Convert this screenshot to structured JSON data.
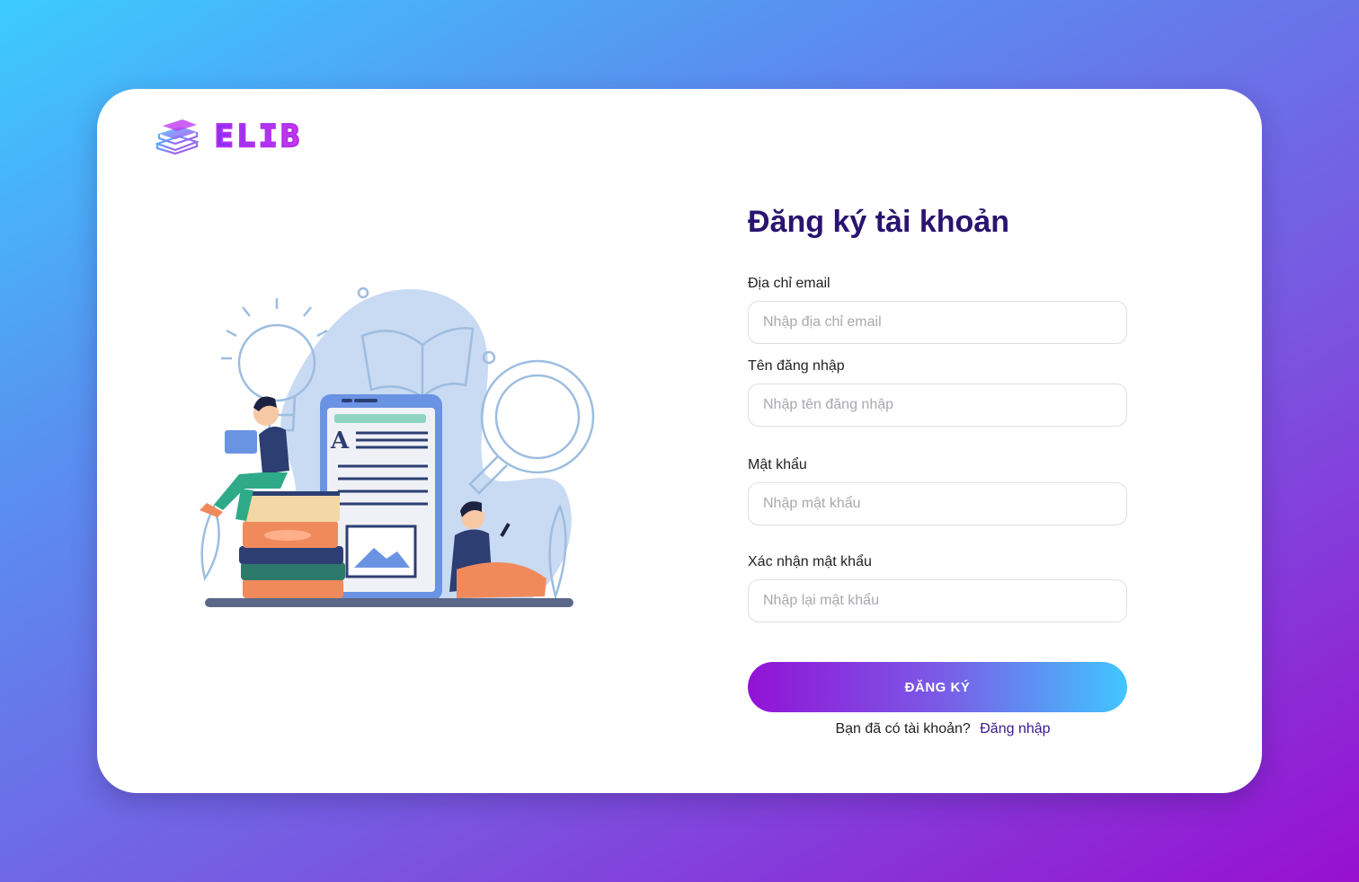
{
  "brand": {
    "name": "ELIB"
  },
  "form": {
    "title": "Đăng ký tài khoản",
    "email": {
      "label": "Địa chỉ email",
      "placeholder": "Nhập địa chỉ email"
    },
    "username": {
      "label": "Tên đăng nhập",
      "placeholder": "Nhập tên đăng nhập"
    },
    "password": {
      "label": "Mật khẩu",
      "placeholder": "Nhập mật khẩu"
    },
    "confirm_password": {
      "label": "Xác nhận mật khẩu",
      "placeholder": "Nhập lại mật khẩu"
    },
    "submit_label": "ĐĂNG KÝ",
    "have_account_text": "Bạn đã có tài khoản?",
    "login_link": "Đăng nhập"
  },
  "colors": {
    "primary_text": "#2a1470",
    "gradient_start": "#9212d6",
    "gradient_end": "#40c6ff"
  },
  "illustration": {
    "letter": "A"
  }
}
